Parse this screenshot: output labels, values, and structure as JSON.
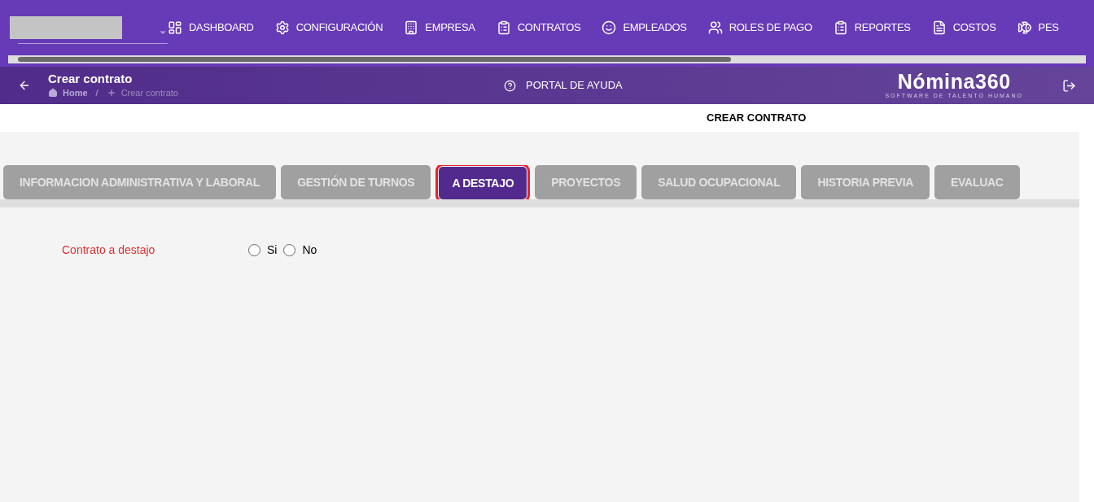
{
  "nav": [
    {
      "label": "DASHBOARD"
    },
    {
      "label": "CONFIGURACIÓN"
    },
    {
      "label": "EMPRESA"
    },
    {
      "label": "CONTRATOS"
    },
    {
      "label": "EMPLEADOS"
    },
    {
      "label": "ROLES DE PAGO"
    },
    {
      "label": "REPORTES"
    },
    {
      "label": "COSTOS"
    },
    {
      "label": "PES"
    }
  ],
  "header": {
    "title": "Crear contrato",
    "breadcrumb": [
      "Home",
      "/",
      "Crear contrato"
    ],
    "help": "PORTAL DE AYUDA",
    "logo": "Nómina360",
    "logo_tagline": "SOFTWARE DE TALENTO HUMANO"
  },
  "page_title": "CREAR CONTRATO",
  "tabs": [
    {
      "label": "INFORMACION ADMINISTRATIVA Y LABORAL",
      "selected": false
    },
    {
      "label": "GESTIÓN DE TURNOS",
      "selected": false
    },
    {
      "label": "A DESTAJO",
      "selected": true
    },
    {
      "label": "PROYECTOS",
      "selected": false
    },
    {
      "label": "SALUD OCUPACIONAL",
      "selected": false
    },
    {
      "label": "HISTORIA PREVIA",
      "selected": false
    },
    {
      "label": "EVALUAC",
      "selected": false
    }
  ],
  "field": {
    "label": "Contrato a destajo",
    "options": [
      {
        "label": "Si",
        "selected": false
      },
      {
        "label": "No",
        "selected": false
      }
    ]
  }
}
